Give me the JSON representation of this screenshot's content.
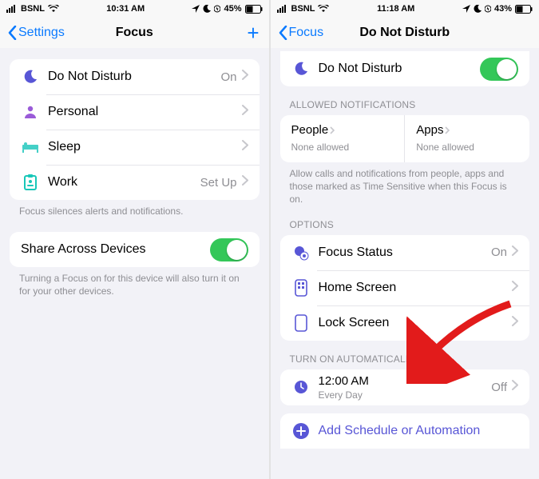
{
  "left": {
    "status": {
      "carrier": "BSNL",
      "time": "10:31 AM",
      "battery": "45%"
    },
    "nav": {
      "back": "Settings",
      "title": "Focus"
    },
    "focusList": [
      {
        "label": "Do Not Disturb",
        "detail": "On"
      },
      {
        "label": "Personal",
        "detail": ""
      },
      {
        "label": "Sleep",
        "detail": ""
      },
      {
        "label": "Work",
        "detail": "Set Up"
      }
    ],
    "footer1": "Focus silences alerts and notifications.",
    "shareRow": {
      "label": "Share Across Devices"
    },
    "footer2": "Turning a Focus on for this device will also turn it on for your other devices."
  },
  "right": {
    "status": {
      "carrier": "BSNL",
      "time": "11:18 AM",
      "battery": "43%"
    },
    "nav": {
      "back": "Focus",
      "title": "Do Not Disturb"
    },
    "dndRow": {
      "label": "Do Not Disturb"
    },
    "allowedHeader": "ALLOWED NOTIFICATIONS",
    "allowed": {
      "peopleLabel": "People",
      "peopleSub": "None allowed",
      "appsLabel": "Apps",
      "appsSub": "None allowed"
    },
    "allowedFooter": "Allow calls and notifications from people, apps and those marked as Time Sensitive when this Focus is on.",
    "optionsHeader": "OPTIONS",
    "options": [
      {
        "label": "Focus Status",
        "detail": "On"
      },
      {
        "label": "Home Screen",
        "detail": ""
      },
      {
        "label": "Lock Screen",
        "detail": ""
      }
    ],
    "autoHeader": "TURN ON AUTOMATICALLY",
    "schedule": {
      "time": "12:00 AM",
      "repeat": "Every Day",
      "state": "Off"
    },
    "addRow": {
      "label": "Add Schedule or Automation"
    }
  }
}
